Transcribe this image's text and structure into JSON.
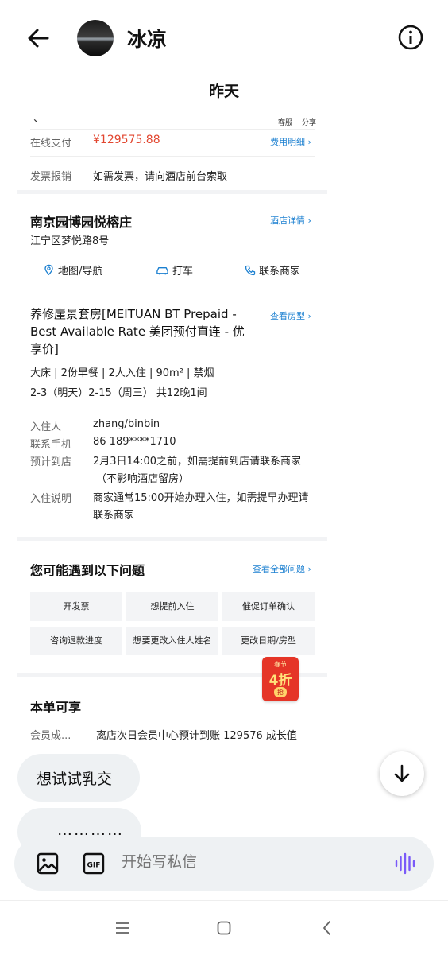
{
  "header": {
    "contact_name": "冰凉"
  },
  "date_divider": "昨天",
  "order": {
    "top_mark": "、",
    "top_actions": [
      "客服",
      "分享"
    ],
    "payment_label": "在线支付",
    "payment_amount": "¥129575.88",
    "payment_link": "费用明细 ›",
    "invoice_label": "发票报销",
    "invoice_text": "如需发票，请向酒店前台索取",
    "hotel_name": "南京园博园悦榕庄",
    "hotel_link": "酒店详情 ›",
    "hotel_address": "江宁区梦悦路8号",
    "actions": [
      "地图/导航",
      "打车",
      "联系商家"
    ],
    "room_title_lines": [
      "养修崖景套房[MEITUAN BT Prepaid -",
      "Best Available Rate 美团预付直连 - 优",
      "享价]"
    ],
    "room_link": "查看房型 ›",
    "room_specs": "大床 | 2份早餐 | 2人入住 | 90m² | 禁烟",
    "room_dates": "2-3（明天）2-15（周三） 共12晚1间",
    "guest_label": "入住人",
    "guest_value": "zhang/binbin",
    "phone_label": "联系手机",
    "phone_value": "86 189****1710",
    "arrival_label": "预计到店",
    "arrival_lines": [
      "2月3日14:00之前，如需提前到店请联系商家",
      "（不影响酒店留房）"
    ],
    "checkin_label": "入住说明",
    "checkin_lines": [
      "商家通常15:00开始办理入住，如需提早办理请",
      "联系商家"
    ],
    "faq_title": "您可能遇到以下问题",
    "faq_link": "查看全部问题 ›",
    "faq_items": [
      "开发票",
      "想提前入住",
      "催促订单确认",
      "咨询退款进度",
      "想要更改入住人姓名",
      "更改日期/房型"
    ],
    "promo_top": "春节",
    "promo_mid": "4折",
    "promo_bottom": "抢",
    "share_title": "本单可享",
    "member_label": "会员成...",
    "member_text": "离店次日会员中心预计到账 129576 成长值"
  },
  "bubbles": {
    "suggestion_1": "想试试乳交",
    "suggestion_2_partial": "…………"
  },
  "composer": {
    "placeholder": "开始写私信"
  },
  "colors": {
    "link": "#1a7fd0",
    "price": "#e2462f",
    "voice": "#7a5af8"
  }
}
